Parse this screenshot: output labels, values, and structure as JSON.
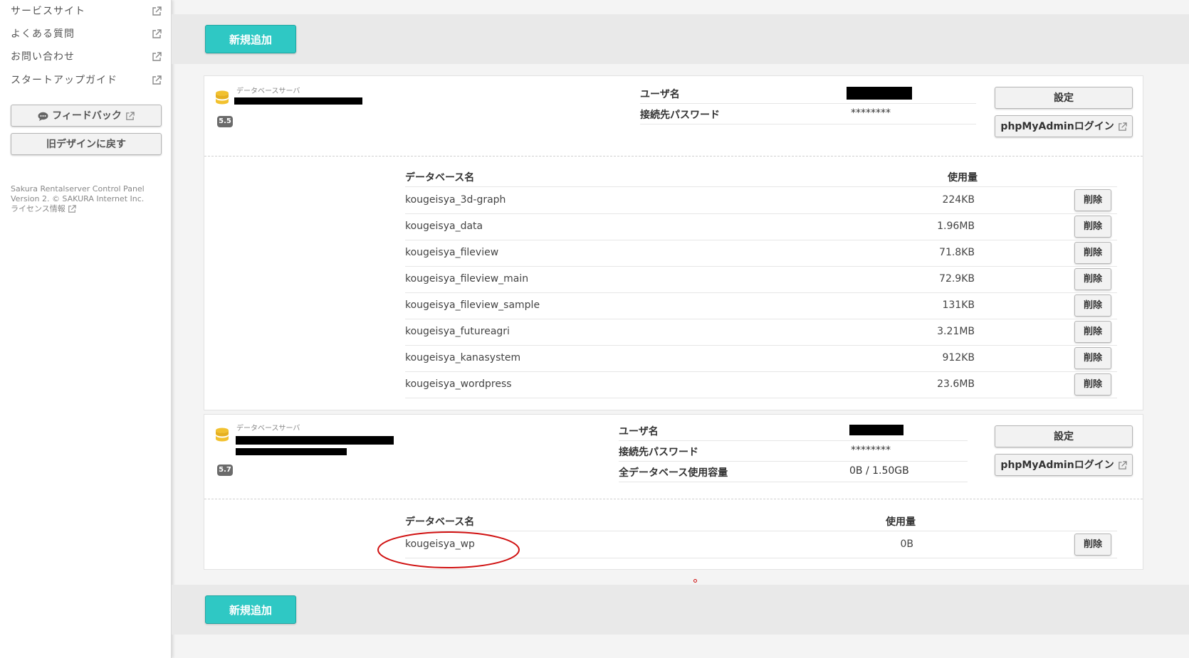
{
  "sidebar": {
    "links": [
      {
        "label": "サービスサイト"
      },
      {
        "label": "よくある質問"
      },
      {
        "label": "お問い合わせ"
      },
      {
        "label": "スタートアップガイド"
      }
    ],
    "feedback_label": "フィードバック",
    "old_design_label": "旧デザインに戻す",
    "footer_line1": "Sakura Rentalserver Control Panel",
    "footer_line2": "Version 2. © SAKURA Internet Inc.",
    "license_label": "ライセンス情報"
  },
  "add_button_label": "新規追加",
  "servers": [
    {
      "server_label": "データベースサーバ",
      "version": "5.5",
      "info": [
        {
          "key": "ユーザ名",
          "value": ""
        },
        {
          "key": "接続先パスワード",
          "value": "********"
        }
      ],
      "settings_label": "設定",
      "phpmyadmin_label": "phpMyAdminログイン",
      "col_name": "データベース名",
      "col_usage": "使用量",
      "databases": [
        {
          "name": "kougeisya_3d-graph",
          "size": "224KB"
        },
        {
          "name": "kougeisya_data",
          "size": "1.96MB"
        },
        {
          "name": "kougeisya_fileview",
          "size": "71.8KB"
        },
        {
          "name": "kougeisya_fileview_main",
          "size": "72.9KB"
        },
        {
          "name": "kougeisya_fileview_sample",
          "size": "131KB"
        },
        {
          "name": "kougeisya_futureagri",
          "size": "3.21MB"
        },
        {
          "name": "kougeisya_kanasystem",
          "size": "912KB"
        },
        {
          "name": "kougeisya_wordpress",
          "size": "23.6MB"
        }
      ],
      "delete_label": "削除"
    },
    {
      "server_label": "データベースサーバ",
      "version": "5.7",
      "info": [
        {
          "key": "ユーザ名",
          "value": ""
        },
        {
          "key": "接続先パスワード",
          "value": "********"
        },
        {
          "key": "全データベース使用容量",
          "value": "0B / 1.50GB"
        }
      ],
      "settings_label": "設定",
      "phpmyadmin_label": "phpMyAdminログイン",
      "col_name": "データベース名",
      "col_usage": "使用量",
      "databases": [
        {
          "name": "kougeisya_wp",
          "size": "0B"
        }
      ],
      "delete_label": "削除"
    }
  ],
  "colors": {
    "accent": "#2fc8c4",
    "annotation": "#d01010",
    "db_icon": "#f2c12e"
  }
}
